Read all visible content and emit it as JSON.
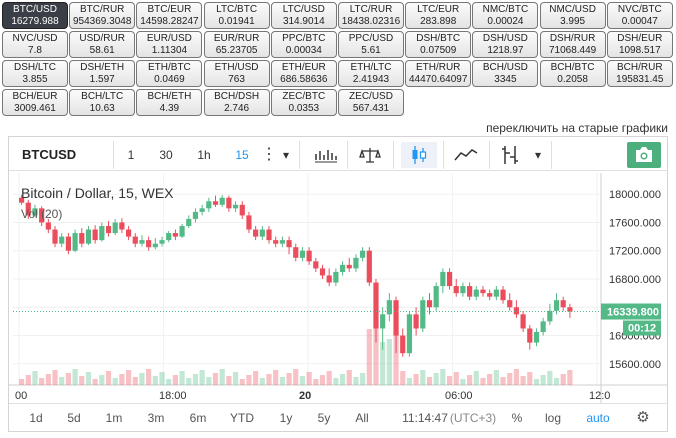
{
  "pairs": [
    {
      "name": "BTC/USD",
      "value": "16279.988",
      "active": true
    },
    {
      "name": "BTC/RUR",
      "value": "954369.3048"
    },
    {
      "name": "BTC/EUR",
      "value": "14598.28247"
    },
    {
      "name": "LTC/BTC",
      "value": "0.01941"
    },
    {
      "name": "LTC/USD",
      "value": "314.9014"
    },
    {
      "name": "LTC/RUR",
      "value": "18438.02316"
    },
    {
      "name": "LTC/EUR",
      "value": "283.898"
    },
    {
      "name": "NMC/BTC",
      "value": "0.00024"
    },
    {
      "name": "NMC/USD",
      "value": "3.995"
    },
    {
      "name": "NVC/BTC",
      "value": "0.00047"
    },
    {
      "name": "NVC/USD",
      "value": "7.8"
    },
    {
      "name": "USD/RUR",
      "value": "58.61"
    },
    {
      "name": "EUR/USD",
      "value": "1.11304"
    },
    {
      "name": "EUR/RUR",
      "value": "65.23705"
    },
    {
      "name": "PPC/BTC",
      "value": "0.00034"
    },
    {
      "name": "PPC/USD",
      "value": "5.61"
    },
    {
      "name": "DSH/BTC",
      "value": "0.07509"
    },
    {
      "name": "DSH/USD",
      "value": "1218.97"
    },
    {
      "name": "DSH/RUR",
      "value": "71068.449"
    },
    {
      "name": "DSH/EUR",
      "value": "1098.517"
    },
    {
      "name": "DSH/LTC",
      "value": "3.855"
    },
    {
      "name": "DSH/ETH",
      "value": "1.597"
    },
    {
      "name": "ETH/BTC",
      "value": "0.0469"
    },
    {
      "name": "ETH/USD",
      "value": "763"
    },
    {
      "name": "ETH/EUR",
      "value": "686.58636"
    },
    {
      "name": "ETH/LTC",
      "value": "2.41943"
    },
    {
      "name": "ETH/RUR",
      "value": "44470.64097"
    },
    {
      "name": "BCH/USD",
      "value": "3345"
    },
    {
      "name": "BCH/BTC",
      "value": "0.2058"
    },
    {
      "name": "BCH/RUR",
      "value": "195831.45"
    },
    {
      "name": "BCH/EUR",
      "value": "3009.461"
    },
    {
      "name": "BCH/LTC",
      "value": "10.63"
    },
    {
      "name": "BCH/ETH",
      "value": "4.39"
    },
    {
      "name": "BCH/DSH",
      "value": "2.746"
    },
    {
      "name": "ZEC/BTC",
      "value": "0.0353"
    },
    {
      "name": "ZEC/USD",
      "value": "567.431"
    }
  ],
  "switch_link": "переключить на старые графики",
  "toolbar": {
    "symbol": "BTCUSD",
    "intervals": [
      "1",
      "30",
      "1h",
      "15"
    ],
    "active_interval": "15",
    "more": "⋮",
    "dropdown": "▾"
  },
  "legend": {
    "title": "Bitcoin / Dollar, 15, WEX",
    "volume": "Vol (20)"
  },
  "chart_data": {
    "type": "candlestick",
    "ylim": [
      15300,
      18300
    ],
    "yticks": [
      "18000.000",
      "17600.000",
      "17200.000",
      "16800.000",
      "16400.000",
      "16000.000",
      "15600.000"
    ],
    "xticks": [
      "00",
      "18:00",
      "20",
      "06:00",
      "12:0"
    ],
    "last_price": "16339.800",
    "countdown": "00:12",
    "candles": [
      [
        17950,
        17880,
        17990,
        17850
      ],
      [
        17880,
        17700,
        17920,
        17650
      ],
      [
        17700,
        17800,
        17850,
        17680
      ],
      [
        17800,
        17600,
        17830,
        17550
      ],
      [
        17600,
        17500,
        17650,
        17450
      ],
      [
        17500,
        17300,
        17550,
        17250
      ],
      [
        17300,
        17400,
        17450,
        17250
      ],
      [
        17400,
        17200,
        17450,
        17150
      ],
      [
        17200,
        17450,
        17500,
        17180
      ],
      [
        17450,
        17300,
        17520,
        17250
      ],
      [
        17300,
        17500,
        17550,
        17280
      ],
      [
        17500,
        17350,
        17560,
        17300
      ],
      [
        17350,
        17550,
        17600,
        17330
      ],
      [
        17550,
        17450,
        17620,
        17400
      ],
      [
        17450,
        17600,
        17650,
        17420
      ],
      [
        17600,
        17500,
        17660,
        17450
      ],
      [
        17500,
        17400,
        17550,
        17350
      ],
      [
        17400,
        17300,
        17450,
        17250
      ],
      [
        17300,
        17350,
        17420,
        17260
      ],
      [
        17350,
        17250,
        17400,
        17200
      ],
      [
        17250,
        17300,
        17380,
        17220
      ],
      [
        17300,
        17350,
        17400,
        17260
      ],
      [
        17350,
        17450,
        17480,
        17320
      ],
      [
        17450,
        17400,
        17500,
        17350
      ],
      [
        17400,
        17550,
        17580,
        17380
      ],
      [
        17550,
        17650,
        17700,
        17520
      ],
      [
        17650,
        17750,
        17800,
        17600
      ],
      [
        17750,
        17800,
        17850,
        17700
      ],
      [
        17800,
        17900,
        17950,
        17750
      ],
      [
        17900,
        17850,
        17980,
        17820
      ],
      [
        17850,
        17950,
        17990,
        17820
      ],
      [
        17950,
        17800,
        17980,
        17750
      ],
      [
        17800,
        17850,
        17900,
        17750
      ],
      [
        17850,
        17700,
        17900,
        17650
      ],
      [
        17700,
        17500,
        17750,
        17450
      ],
      [
        17500,
        17400,
        17550,
        17350
      ],
      [
        17400,
        17500,
        17550,
        17350
      ],
      [
        17500,
        17350,
        17550,
        17300
      ],
      [
        17350,
        17300,
        17400,
        17250
      ],
      [
        17300,
        17350,
        17400,
        17250
      ],
      [
        17350,
        17250,
        17400,
        17150
      ],
      [
        17250,
        17100,
        17300,
        17050
      ],
      [
        17100,
        17200,
        17250,
        17050
      ],
      [
        17200,
        17050,
        17250,
        17000
      ],
      [
        17050,
        16950,
        17100,
        16900
      ],
      [
        16950,
        16850,
        17000,
        16800
      ],
      [
        16850,
        16750,
        16950,
        16700
      ],
      [
        16750,
        16900,
        16950,
        16700
      ],
      [
        16900,
        17000,
        17050,
        16850
      ],
      [
        17000,
        16950,
        17100,
        16900
      ],
      [
        16950,
        17100,
        17150,
        16900
      ],
      [
        17100,
        17200,
        17250,
        17050
      ],
      [
        17200,
        16750,
        17250,
        16700
      ],
      [
        16750,
        16100,
        16800,
        15900
      ],
      [
        16100,
        16300,
        16400,
        15800
      ],
      [
        16300,
        16500,
        16600,
        16200
      ],
      [
        16500,
        16000,
        16550,
        15750
      ],
      [
        16000,
        15750,
        16100,
        15700
      ],
      [
        15750,
        16300,
        16350,
        15700
      ],
      [
        16300,
        16100,
        16400,
        16000
      ],
      [
        16100,
        16500,
        16550,
        16050
      ],
      [
        16500,
        16400,
        16600,
        16300
      ],
      [
        16400,
        16700,
        16750,
        16350
      ],
      [
        16700,
        16900,
        16950,
        16600
      ],
      [
        16900,
        16700,
        16950,
        16650
      ],
      [
        16700,
        16600,
        16800,
        16550
      ],
      [
        16600,
        16700,
        16750,
        16550
      ],
      [
        16700,
        16550,
        16750,
        16500
      ],
      [
        16550,
        16650,
        16700,
        16500
      ],
      [
        16650,
        16600,
        16700,
        16550
      ],
      [
        16600,
        16550,
        16650,
        16500
      ],
      [
        16550,
        16650,
        16700,
        16500
      ],
      [
        16650,
        16500,
        16700,
        16450
      ],
      [
        16500,
        16400,
        16600,
        16350
      ],
      [
        16400,
        16300,
        16500,
        16250
      ],
      [
        16300,
        16100,
        16350,
        16050
      ],
      [
        16100,
        15900,
        16150,
        15800
      ],
      [
        15900,
        16050,
        16100,
        15850
      ],
      [
        16050,
        16200,
        16250,
        16000
      ],
      [
        16200,
        16350,
        16450,
        16150
      ],
      [
        16350,
        16500,
        16600,
        16300
      ],
      [
        16500,
        16400,
        16550,
        16350
      ],
      [
        16400,
        16340,
        16450,
        16250
      ]
    ]
  },
  "bottom_bar": {
    "ranges": [
      "1d",
      "5d",
      "1m",
      "3m",
      "6m",
      "YTD",
      "1y",
      "5y",
      "All"
    ],
    "time": "11:14:47",
    "tz": "(UTC+3)",
    "percent": "%",
    "log": "log",
    "auto": "auto"
  },
  "colors": {
    "up": "#26a69a",
    "down": "#ef5350",
    "up_fill": "#53b987",
    "down_fill": "#eb4d5c",
    "last_price_bg": "#53b987",
    "accent": "#2196f3"
  },
  "icons": {
    "camera": "camera-icon",
    "bars": "bars-style-icon",
    "scale": "compare-icon",
    "candles": "candles-icon",
    "area": "area-chart-icon",
    "indicators": "indicators-icon",
    "gear": "gear-icon"
  }
}
